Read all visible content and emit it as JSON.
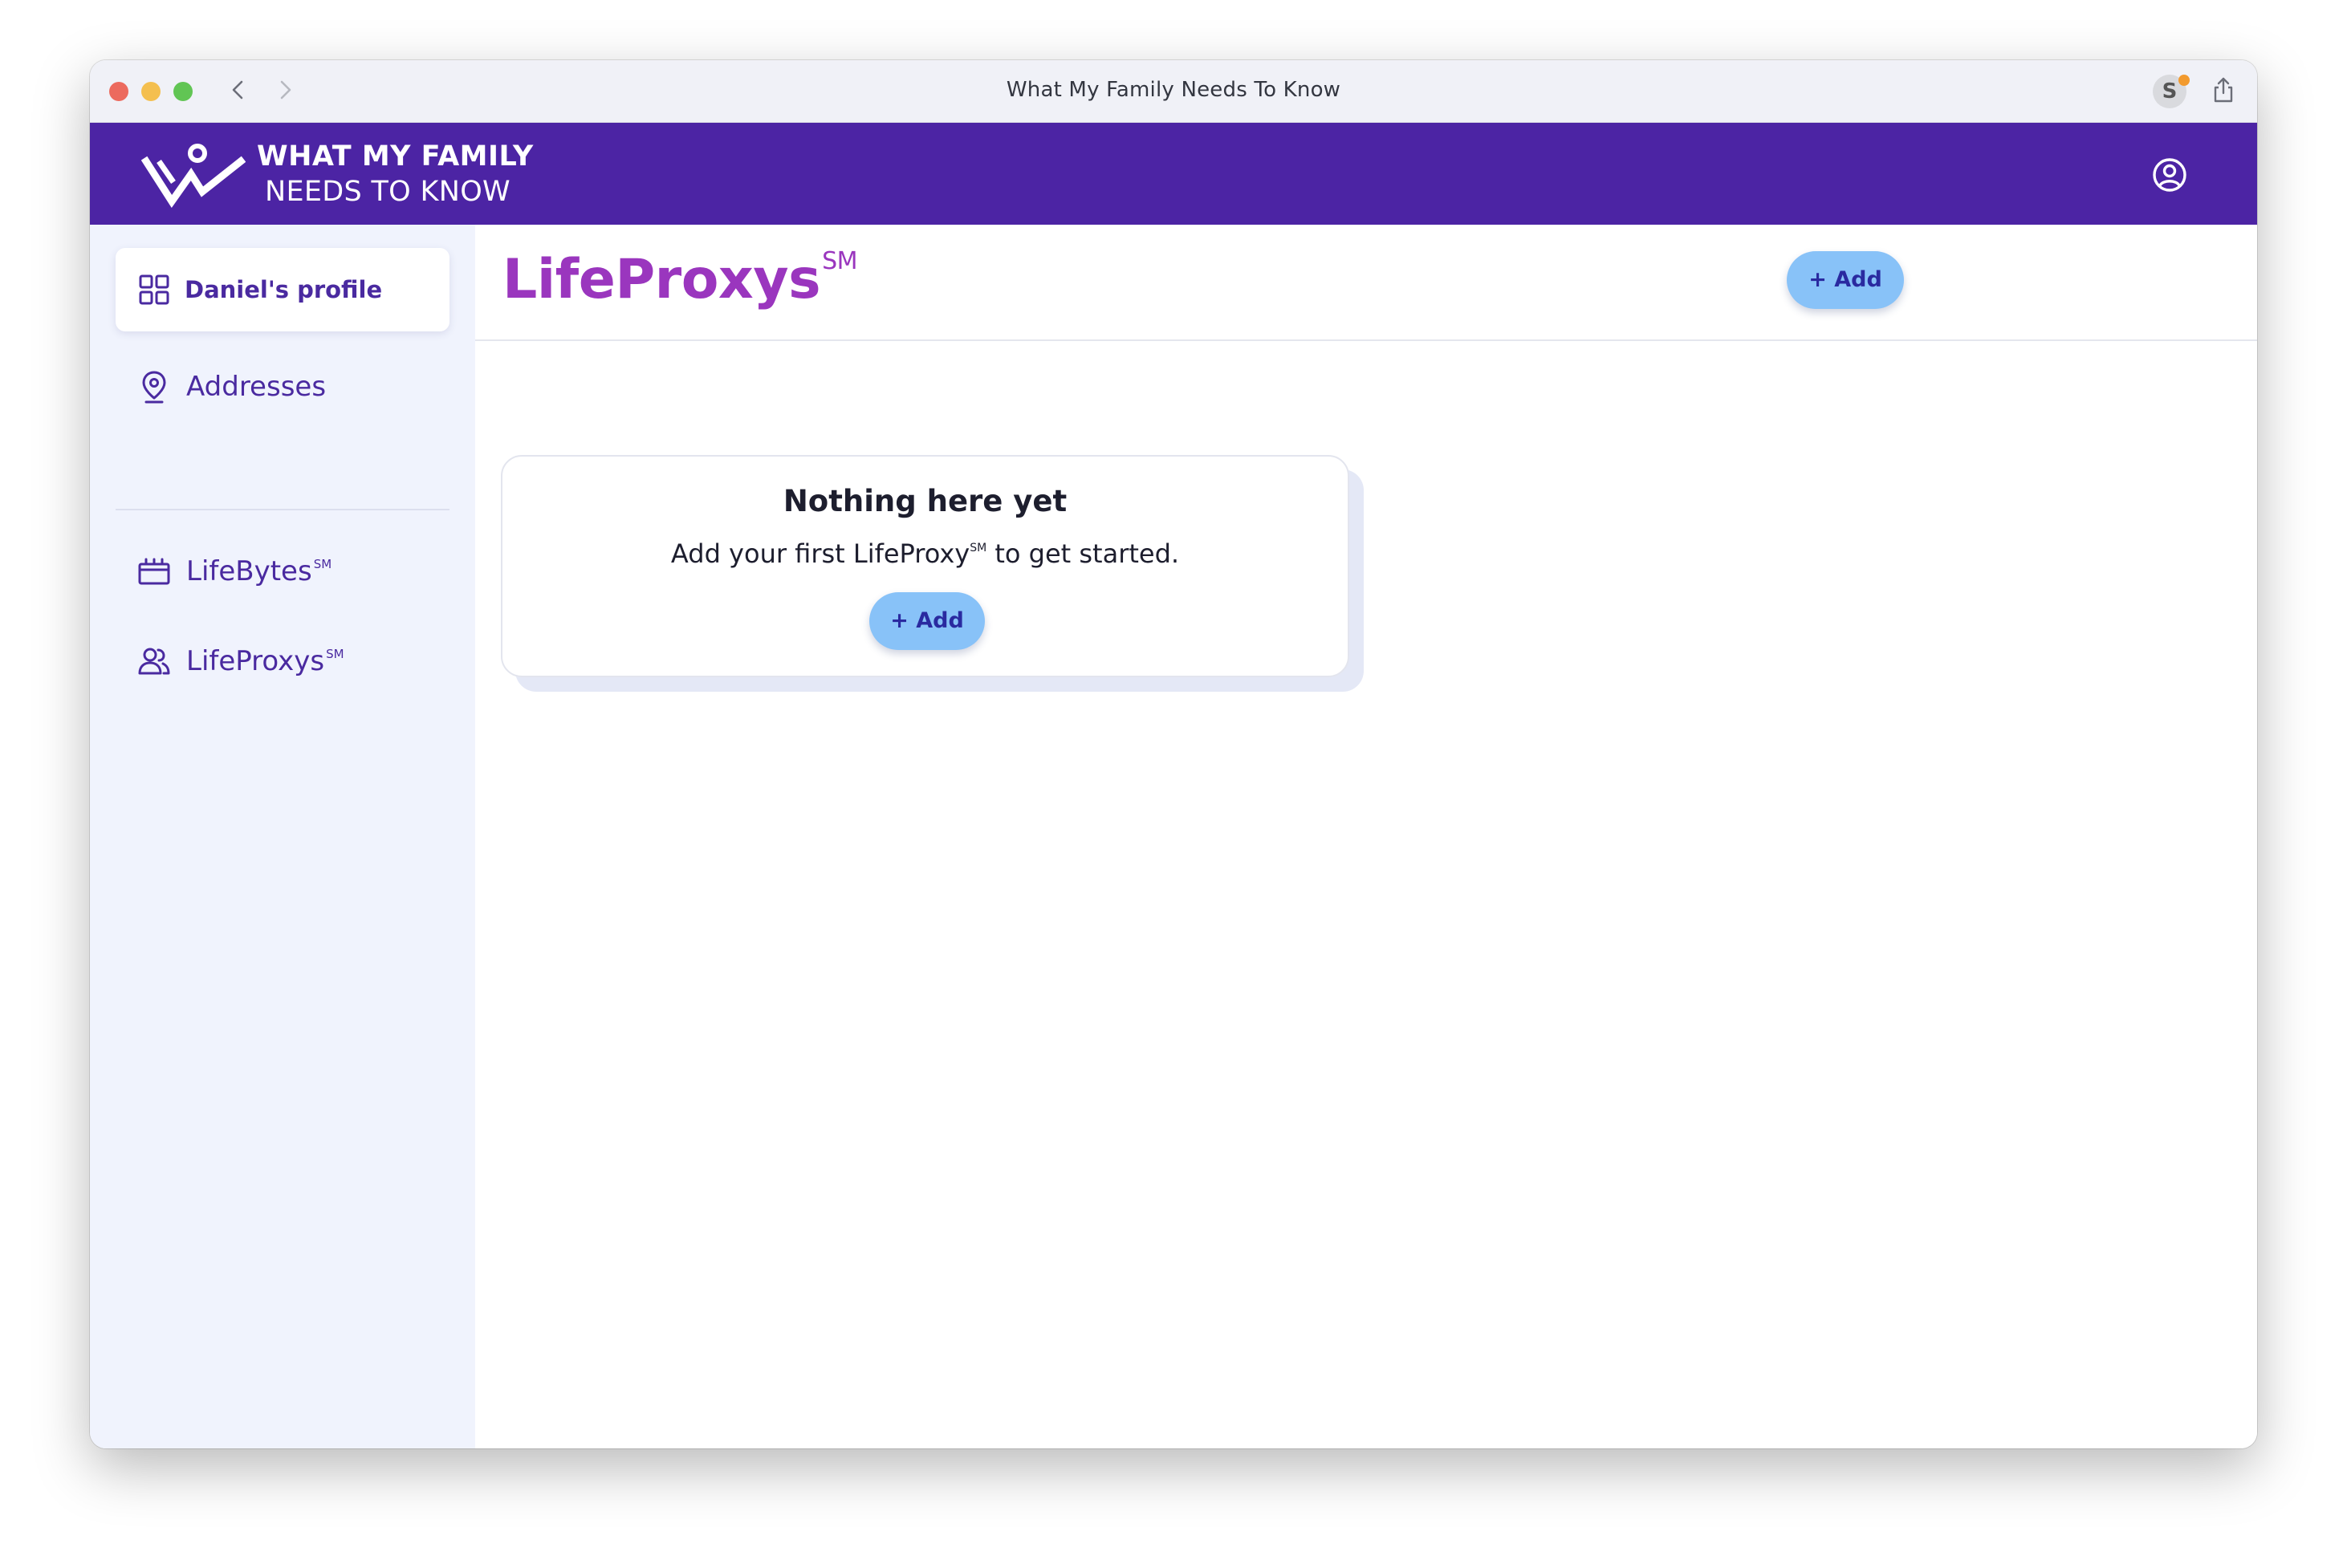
{
  "window": {
    "title": "What My Family Needs To Know"
  },
  "header": {
    "brand_line1": "WHAT MY FAMILY",
    "brand_line2": "NEEDS TO KNOW",
    "brand_color": "#4c24a4"
  },
  "sidebar": {
    "items": [
      {
        "label": "Daniel's profile",
        "icon": "grid-icon",
        "active": true
      },
      {
        "label": "Addresses",
        "icon": "location-pin-icon",
        "active": false
      },
      {
        "label": "LifeBytes",
        "mark": "SM",
        "icon": "briefcase-icon",
        "active": false
      },
      {
        "label": "LifeProxys",
        "mark": "SM",
        "icon": "people-icon",
        "active": false
      }
    ]
  },
  "main": {
    "title": "LifeProxys",
    "title_mark": "SM",
    "add_label": "+ Add",
    "title_color": "#9a36be",
    "empty_state": {
      "heading": "Nothing here yet",
      "text_before": "Add your first LifeProxy",
      "text_mark": "SM",
      "text_after": " to get started.",
      "button_label": "+ Add"
    }
  },
  "colors": {
    "accent": "#88c2f8",
    "sidebar_bg": "#f0f3fd",
    "nav_text": "#4a2aa0"
  }
}
